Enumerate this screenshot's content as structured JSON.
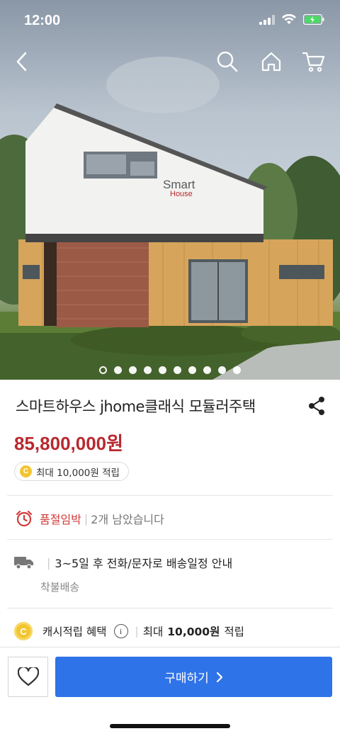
{
  "status_bar": {
    "time": "12:00"
  },
  "hero": {
    "logo_line1": "Smart",
    "logo_line2": "House",
    "slide_count": 10,
    "active_slide": 1
  },
  "product": {
    "title": "스마트하우스 jhome클래식 모듈러주택",
    "price": "85,800,000원",
    "reward_badge": "최대 10,000원 적립",
    "coin_symbol": "C"
  },
  "stock": {
    "label": "품절임박",
    "separator": "|",
    "text": "2개 남았습니다"
  },
  "shipping": {
    "separator": "|",
    "text": "3~5일 후 전화/문자로 배송일정 안내",
    "sub": "착불배송"
  },
  "cashback": {
    "label": "캐시적립 혜택",
    "separator": "|",
    "prefix": "최대",
    "amount": "10,000원",
    "suffix": "적립"
  },
  "bottom_bar": {
    "buy_label": "구매하기"
  },
  "colors": {
    "price": "#b8292f",
    "stock_alert": "#d23a3a",
    "buy_button": "#2f73e8",
    "coin": "#f2c531"
  }
}
